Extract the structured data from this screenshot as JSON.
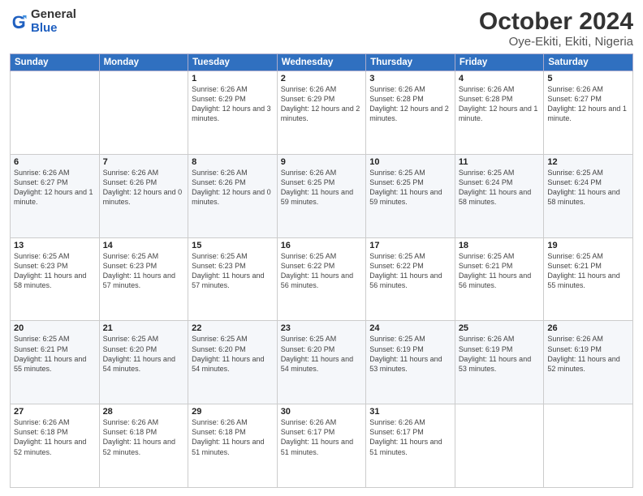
{
  "header": {
    "logo_general": "General",
    "logo_blue": "Blue",
    "month": "October 2024",
    "location": "Oye-Ekiti, Ekiti, Nigeria"
  },
  "weekdays": [
    "Sunday",
    "Monday",
    "Tuesday",
    "Wednesday",
    "Thursday",
    "Friday",
    "Saturday"
  ],
  "weeks": [
    [
      {
        "day": "",
        "info": ""
      },
      {
        "day": "",
        "info": ""
      },
      {
        "day": "1",
        "info": "Sunrise: 6:26 AM\nSunset: 6:29 PM\nDaylight: 12 hours and 3 minutes."
      },
      {
        "day": "2",
        "info": "Sunrise: 6:26 AM\nSunset: 6:29 PM\nDaylight: 12 hours and 2 minutes."
      },
      {
        "day": "3",
        "info": "Sunrise: 6:26 AM\nSunset: 6:28 PM\nDaylight: 12 hours and 2 minutes."
      },
      {
        "day": "4",
        "info": "Sunrise: 6:26 AM\nSunset: 6:28 PM\nDaylight: 12 hours and 1 minute."
      },
      {
        "day": "5",
        "info": "Sunrise: 6:26 AM\nSunset: 6:27 PM\nDaylight: 12 hours and 1 minute."
      }
    ],
    [
      {
        "day": "6",
        "info": "Sunrise: 6:26 AM\nSunset: 6:27 PM\nDaylight: 12 hours and 1 minute."
      },
      {
        "day": "7",
        "info": "Sunrise: 6:26 AM\nSunset: 6:26 PM\nDaylight: 12 hours and 0 minutes."
      },
      {
        "day": "8",
        "info": "Sunrise: 6:26 AM\nSunset: 6:26 PM\nDaylight: 12 hours and 0 minutes."
      },
      {
        "day": "9",
        "info": "Sunrise: 6:26 AM\nSunset: 6:25 PM\nDaylight: 11 hours and 59 minutes."
      },
      {
        "day": "10",
        "info": "Sunrise: 6:25 AM\nSunset: 6:25 PM\nDaylight: 11 hours and 59 minutes."
      },
      {
        "day": "11",
        "info": "Sunrise: 6:25 AM\nSunset: 6:24 PM\nDaylight: 11 hours and 58 minutes."
      },
      {
        "day": "12",
        "info": "Sunrise: 6:25 AM\nSunset: 6:24 PM\nDaylight: 11 hours and 58 minutes."
      }
    ],
    [
      {
        "day": "13",
        "info": "Sunrise: 6:25 AM\nSunset: 6:23 PM\nDaylight: 11 hours and 58 minutes."
      },
      {
        "day": "14",
        "info": "Sunrise: 6:25 AM\nSunset: 6:23 PM\nDaylight: 11 hours and 57 minutes."
      },
      {
        "day": "15",
        "info": "Sunrise: 6:25 AM\nSunset: 6:23 PM\nDaylight: 11 hours and 57 minutes."
      },
      {
        "day": "16",
        "info": "Sunrise: 6:25 AM\nSunset: 6:22 PM\nDaylight: 11 hours and 56 minutes."
      },
      {
        "day": "17",
        "info": "Sunrise: 6:25 AM\nSunset: 6:22 PM\nDaylight: 11 hours and 56 minutes."
      },
      {
        "day": "18",
        "info": "Sunrise: 6:25 AM\nSunset: 6:21 PM\nDaylight: 11 hours and 56 minutes."
      },
      {
        "day": "19",
        "info": "Sunrise: 6:25 AM\nSunset: 6:21 PM\nDaylight: 11 hours and 55 minutes."
      }
    ],
    [
      {
        "day": "20",
        "info": "Sunrise: 6:25 AM\nSunset: 6:21 PM\nDaylight: 11 hours and 55 minutes."
      },
      {
        "day": "21",
        "info": "Sunrise: 6:25 AM\nSunset: 6:20 PM\nDaylight: 11 hours and 54 minutes."
      },
      {
        "day": "22",
        "info": "Sunrise: 6:25 AM\nSunset: 6:20 PM\nDaylight: 11 hours and 54 minutes."
      },
      {
        "day": "23",
        "info": "Sunrise: 6:25 AM\nSunset: 6:20 PM\nDaylight: 11 hours and 54 minutes."
      },
      {
        "day": "24",
        "info": "Sunrise: 6:25 AM\nSunset: 6:19 PM\nDaylight: 11 hours and 53 minutes."
      },
      {
        "day": "25",
        "info": "Sunrise: 6:26 AM\nSunset: 6:19 PM\nDaylight: 11 hours and 53 minutes."
      },
      {
        "day": "26",
        "info": "Sunrise: 6:26 AM\nSunset: 6:19 PM\nDaylight: 11 hours and 52 minutes."
      }
    ],
    [
      {
        "day": "27",
        "info": "Sunrise: 6:26 AM\nSunset: 6:18 PM\nDaylight: 11 hours and 52 minutes."
      },
      {
        "day": "28",
        "info": "Sunrise: 6:26 AM\nSunset: 6:18 PM\nDaylight: 11 hours and 52 minutes."
      },
      {
        "day": "29",
        "info": "Sunrise: 6:26 AM\nSunset: 6:18 PM\nDaylight: 11 hours and 51 minutes."
      },
      {
        "day": "30",
        "info": "Sunrise: 6:26 AM\nSunset: 6:17 PM\nDaylight: 11 hours and 51 minutes."
      },
      {
        "day": "31",
        "info": "Sunrise: 6:26 AM\nSunset: 6:17 PM\nDaylight: 11 hours and 51 minutes."
      },
      {
        "day": "",
        "info": ""
      },
      {
        "day": "",
        "info": ""
      }
    ]
  ]
}
